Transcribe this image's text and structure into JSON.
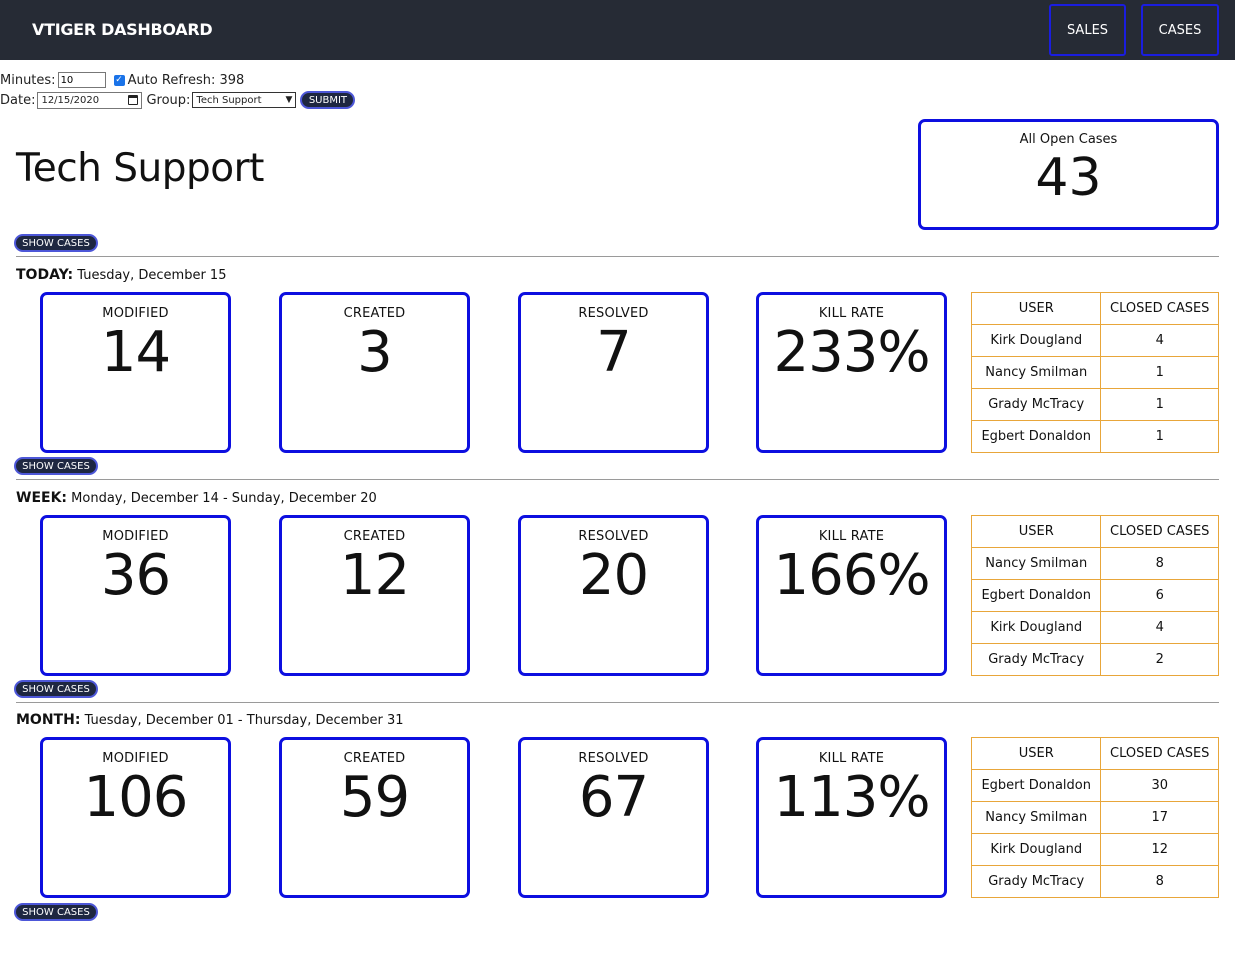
{
  "header": {
    "brand": "VTIGER DASHBOARD",
    "nav": {
      "sales": "SALES",
      "cases": "CASES"
    }
  },
  "controls": {
    "minutes_label": "Minutes:",
    "minutes_value": "10",
    "auto_refresh_checked": true,
    "auto_refresh_label": "Auto Refresh: 398",
    "date_label": "Date:",
    "date_value": "12/15/2020",
    "group_label": "Group:",
    "group_value": "Tech Support",
    "submit_label": "SUBMIT"
  },
  "page": {
    "title": "Tech Support"
  },
  "all_open": {
    "label": "All Open Cases",
    "value": "43"
  },
  "show_cases_label": "SHOW CASES",
  "sections": [
    {
      "key": "TODAY:",
      "range": "Tuesday, December 15",
      "modified": {
        "label": "MODIFIED",
        "value": "14"
      },
      "created": {
        "label": "CREATED",
        "value": "3"
      },
      "resolved": {
        "label": "RESOLVED",
        "value": "7"
      },
      "kill_rate": {
        "label": "KILL RATE",
        "value": "233%"
      },
      "table": {
        "headers": [
          "USER",
          "CLOSED CASES"
        ],
        "rows": [
          [
            "Kirk Dougland",
            "4"
          ],
          [
            "Nancy Smilman",
            "1"
          ],
          [
            "Grady McTracy",
            "1"
          ],
          [
            "Egbert Donaldon",
            "1"
          ]
        ]
      }
    },
    {
      "key": "WEEK:",
      "range": "Monday, December 14 - Sunday, December 20",
      "modified": {
        "label": "MODIFIED",
        "value": "36"
      },
      "created": {
        "label": "CREATED",
        "value": "12"
      },
      "resolved": {
        "label": "RESOLVED",
        "value": "20"
      },
      "kill_rate": {
        "label": "KILL RATE",
        "value": "166%"
      },
      "table": {
        "headers": [
          "USER",
          "CLOSED CASES"
        ],
        "rows": [
          [
            "Nancy Smilman",
            "8"
          ],
          [
            "Egbert Donaldon",
            "6"
          ],
          [
            "Kirk Dougland",
            "4"
          ],
          [
            "Grady McTracy",
            "2"
          ]
        ]
      }
    },
    {
      "key": "MONTH:",
      "range": "Tuesday, December 01 - Thursday, December 31",
      "modified": {
        "label": "MODIFIED",
        "value": "106"
      },
      "created": {
        "label": "CREATED",
        "value": "59"
      },
      "resolved": {
        "label": "RESOLVED",
        "value": "67"
      },
      "kill_rate": {
        "label": "KILL RATE",
        "value": "113%"
      },
      "table": {
        "headers": [
          "USER",
          "CLOSED CASES"
        ],
        "rows": [
          [
            "Egbert Donaldon",
            "30"
          ],
          [
            "Nancy Smilman",
            "17"
          ],
          [
            "Kirk Dougland",
            "12"
          ],
          [
            "Grady McTracy",
            "8"
          ]
        ]
      }
    }
  ],
  "colors": {
    "navbar": "#262b35",
    "card_border": "#0d0fe0",
    "table_border": "#e8a63a",
    "button_bg": "#1e2741"
  }
}
